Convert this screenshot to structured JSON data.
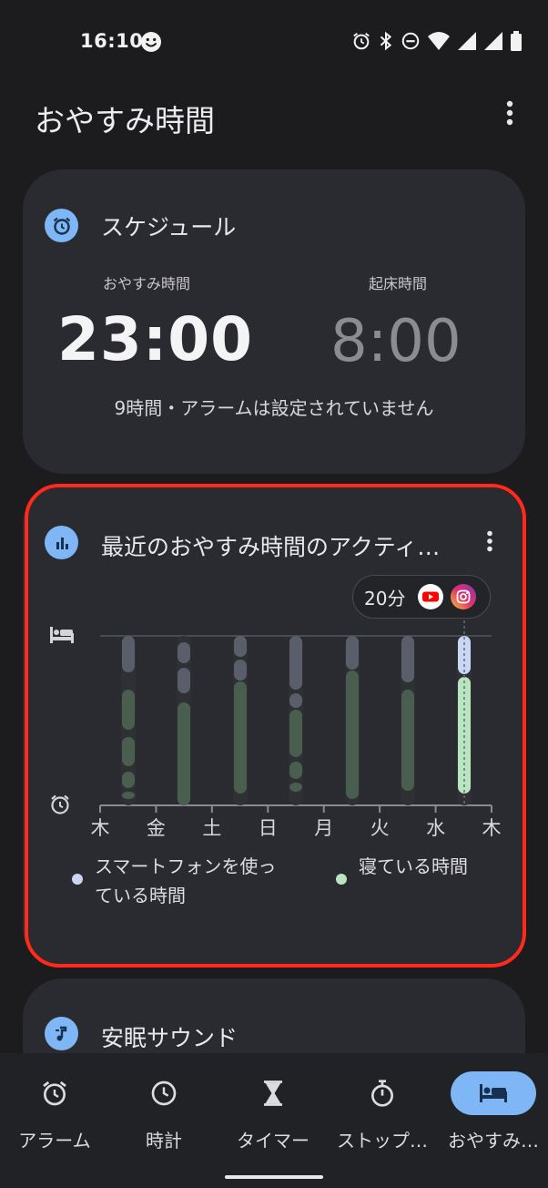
{
  "status_bar": {
    "time": "16:10",
    "icons": [
      "smiley-icon",
      "alarm-icon",
      "bluetooth-icon",
      "dnd-icon",
      "wifi-icon",
      "signal-icon",
      "signal-icon",
      "battery-icon"
    ]
  },
  "header": {
    "title": "おやすみ時間",
    "menu_icon": "more-vert-icon"
  },
  "schedule": {
    "title": "スケジュール",
    "icon": "alarm-icon",
    "bedtime_label": "おやすみ時間",
    "bedtime": "23:00",
    "wake_label": "起床時間",
    "wake": "8:00",
    "summary": "9時間・アラームは設定されていません"
  },
  "activity": {
    "title": "最近のおやすみ時間のアクティ…",
    "icon": "bar-chart-icon",
    "usage_pill": {
      "label": "20分",
      "apps": [
        "youtube-icon",
        "instagram-icon"
      ]
    },
    "legend": {
      "phone_line1": "スマートフォンを使っ",
      "phone_line2": "ている時間",
      "sleep": "寝ている時間"
    },
    "colors": {
      "phone": "#c9d6f5",
      "sleep": "#b8e6c0",
      "sleep_dim": "#4a5e50",
      "phone_dim": "#5a5e6b"
    }
  },
  "chart_data": {
    "type": "bar",
    "categories": [
      "木",
      "金",
      "土",
      "日",
      "月",
      "火",
      "水",
      "木"
    ],
    "y_top_icon": "bed-icon",
    "y_bottom_icon": "alarm-icon",
    "series": [
      {
        "name": "スマートフォンを使っている時間"
      },
      {
        "name": "寝ている時間"
      }
    ]
  },
  "sound": {
    "title": "安眠サウンド",
    "icon": "music-note-icon"
  },
  "bottom_nav": {
    "items": [
      {
        "label": "アラーム",
        "icon": "alarm-icon"
      },
      {
        "label": "時計",
        "icon": "clock-icon"
      },
      {
        "label": "タイマー",
        "icon": "hourglass-icon"
      },
      {
        "label": "ストップ…",
        "icon": "stopwatch-icon"
      },
      {
        "label": "おやすみ…",
        "icon": "bed-icon"
      }
    ]
  }
}
